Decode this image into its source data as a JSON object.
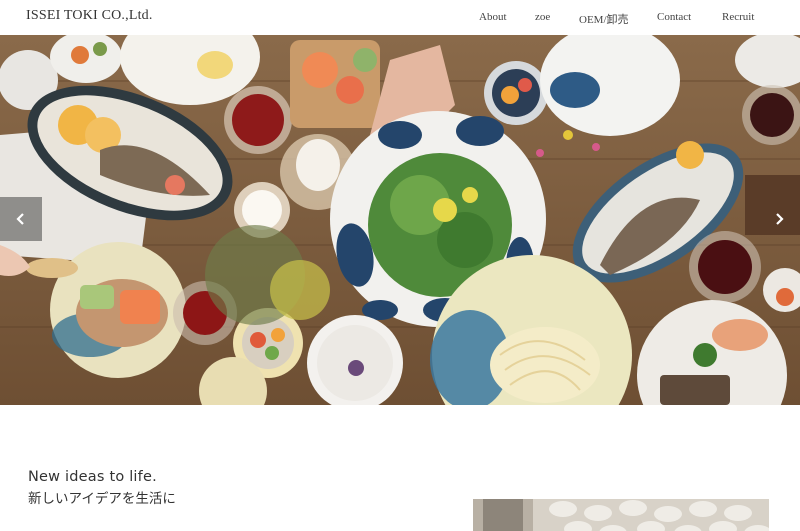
{
  "header": {
    "logo": "ISSEI TOKI CO.,Ltd.",
    "nav": [
      {
        "label": "About"
      },
      {
        "label": "zoe"
      },
      {
        "label": "OEM/卸売"
      },
      {
        "label": "Contact"
      },
      {
        "label": "Recruit"
      }
    ]
  },
  "hero": {
    "prev_icon": "chevron-left-icon",
    "next_icon": "chevron-right-icon"
  },
  "intro": {
    "title_en": "New ideas to life.",
    "title_jp": "新しいアイデアを生活に"
  },
  "colors": {
    "table_wood": "#7a5a3c",
    "plate_blue": "#2f5f8a",
    "text": "#333333"
  }
}
